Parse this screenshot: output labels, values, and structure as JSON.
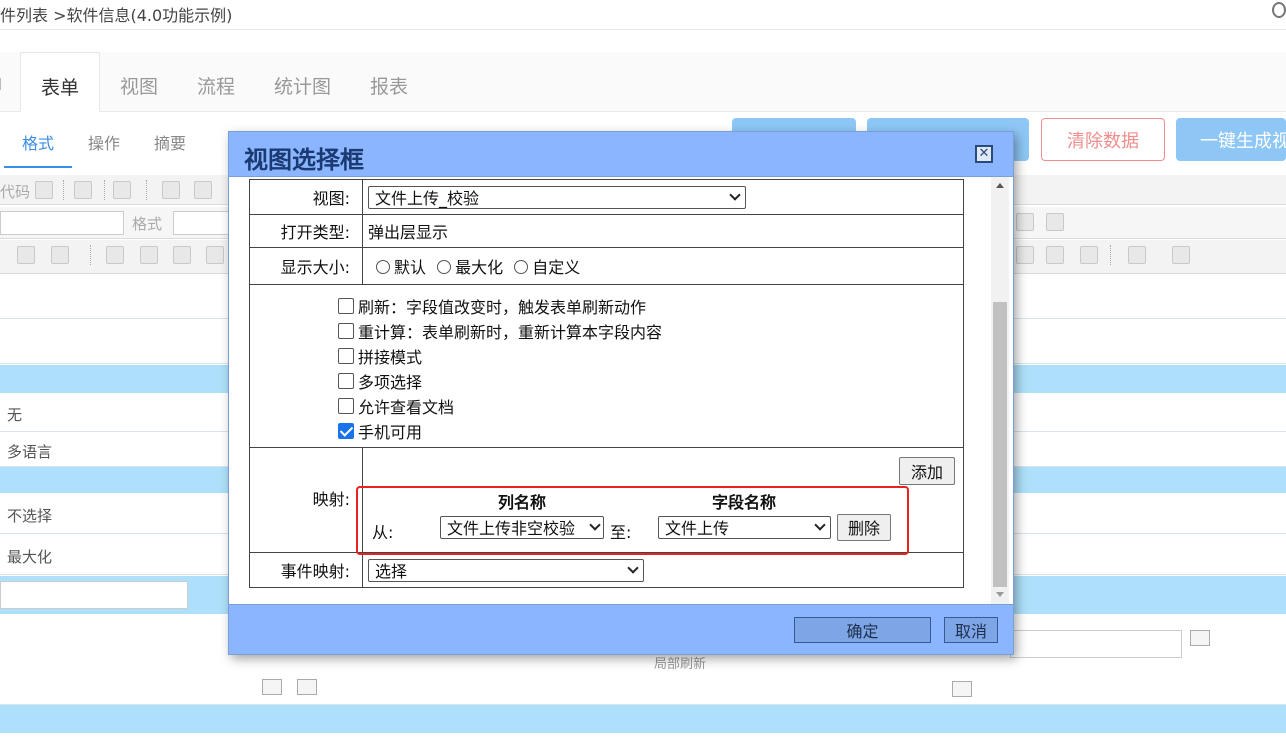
{
  "breadcrumb": "件列表 >软件信息(4.0功能示例)",
  "tabs": [
    "表单",
    "视图",
    "流程",
    "统计图",
    "报表"
  ],
  "subtabs": [
    "格式",
    "操作",
    "摘要"
  ],
  "top_buttons": {
    "clear": "清除数据",
    "generate": "一键生成视"
  },
  "toolbar": {
    "code_text": "代码",
    "format_text": "格式"
  },
  "background_rows": {
    "none": "无",
    "multilang": "多语言",
    "noselect": "不选择",
    "maximize": "最大化",
    "partial_refresh": "局部刷新"
  },
  "dialog": {
    "title": "视图选择框",
    "view_label": "视图:",
    "view_value": "文件上传_校验",
    "open_type_label": "打开类型:",
    "open_type_value": "弹出层显示",
    "size_label": "显示大小:",
    "size_options": [
      "默认",
      "最大化",
      "自定义"
    ],
    "options": [
      {
        "label": "刷新：字段值改变时，触发表单刷新动作",
        "checked": false
      },
      {
        "label": "重计算：表单刷新时，重新计算本字段内容",
        "checked": false
      },
      {
        "label": "拼接模式",
        "checked": false
      },
      {
        "label": "多项选择",
        "checked": false
      },
      {
        "label": "允许查看文档",
        "checked": false
      },
      {
        "label": "手机可用",
        "checked": true
      }
    ],
    "mapping_label": "映射:",
    "add_button": "添加",
    "column_header": "列名称",
    "field_header": "字段名称",
    "from_label": "从:",
    "from_value": "文件上传非空校验",
    "to_label": "至:",
    "to_value": "文件上传",
    "delete_button": "删除",
    "event_mapping_label": "事件映射:",
    "event_mapping_value": "选择",
    "ok_button": "确定",
    "cancel_button": "取消"
  },
  "colors": {
    "dialog_frame": "#8bb6ff",
    "title_text": "#1b3a72",
    "highlight": "#e8221e",
    "band": "#aee0fb",
    "accent": "#3a8ee6"
  }
}
